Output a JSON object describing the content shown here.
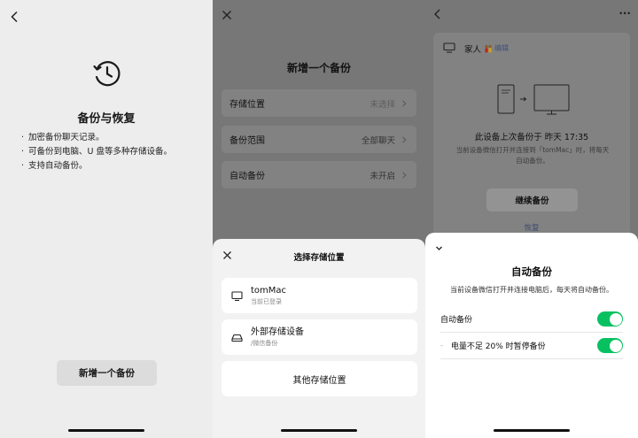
{
  "panel1": {
    "title": "备份与恢复",
    "bullets": [
      "加密备份聊天记录。",
      "可备份到电脑、U 盘等多种存储设备。",
      "支持自动备份。"
    ],
    "button": "新增一个备份"
  },
  "panel2": {
    "title": "新增一个备份",
    "rows": [
      {
        "label": "存储位置",
        "value": "未选择"
      },
      {
        "label": "备份范围",
        "value": "全部聊天"
      },
      {
        "label": "自动备份",
        "value": "未开启"
      }
    ],
    "sheet": {
      "title": "选择存储位置",
      "options": [
        {
          "name": "tomMac",
          "sub": "当前已登录",
          "icon": "monitor-icon"
        },
        {
          "name": "外部存储设备",
          "sub": "/微信备份",
          "icon": "external-drive-icon"
        }
      ],
      "other": "其他存储位置"
    }
  },
  "panel3": {
    "more": "···",
    "device": {
      "name": "家人",
      "edit": "编辑"
    },
    "last_backup": "此设备上次备份于 昨天 17:35",
    "desc": "当前设备微信打开并连接到「tomMac」时，将每天自动备份。",
    "continue": "继续备份",
    "restore": "恢复",
    "sheet": {
      "title": "自动备份",
      "desc": "当前设备微信打开并连接电脑后，每天将自动备份。",
      "toggle_label": "自动备份",
      "sub_dash": "-",
      "sub_label": "电量不足 20% 时暂停备份"
    }
  },
  "colors": {
    "toggle_on": "#07c160",
    "link": "#43507a"
  }
}
